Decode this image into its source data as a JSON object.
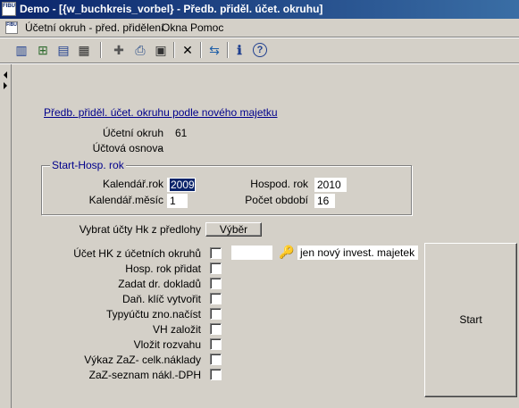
{
  "window": {
    "title": "Demo - [{w_buchkreis_vorbel} - Předb. přiděl. účet. okruhu]",
    "app_icon_text": "FIBU"
  },
  "menu": {
    "items": [
      "Účetní okruh - před. přidělení",
      "Okna",
      "Pomoc"
    ]
  },
  "toolbar": {
    "icons": [
      "columns-icon",
      "tree-icon",
      "book-icon",
      "calculator-icon",
      "plus-icon",
      "printer-icon",
      "preview-icon",
      "close-icon",
      "transfer-icon",
      "info-icon",
      "help-icon"
    ],
    "glyphs": {
      "columns": "▥",
      "tree": "⊞",
      "book": "▤",
      "calc": "▦",
      "plus": "✚",
      "print": "⎙",
      "preview": "▣",
      "close": "✕",
      "transfer": "⇆",
      "info": "ℹ",
      "help": "?"
    }
  },
  "form": {
    "heading_link": "Předb. přiděl. účet. okruhu podle nového majetku",
    "ucetni_okruh_label": "Účetní okruh",
    "ucetni_okruh_value": "61",
    "uctova_osnova_label": "Účtová osnova",
    "uctova_osnova_value": "-",
    "group_title": "Start-Hosp. rok",
    "kalendar_rok_label": "Kalendář.rok",
    "kalendar_rok_value": "2009",
    "hospod_rok_label": "Hospod. rok",
    "hospod_rok_value": "2010",
    "kalendar_mesic_label": "Kalendář.měsíc",
    "kalendar_mesic_value": "1",
    "pocet_obdobi_label": "Počet období",
    "pocet_obdobi_value": "16",
    "vybrat_label": "Vybrat účty Hk z předlohy",
    "vyber_button": "Výběr",
    "ucet_hk_label": "Účet HK z účetních okruhů",
    "ucet_hk_value": "",
    "invest_text": "jen nový invest. majetek",
    "start_button": "Start"
  },
  "checkboxes": [
    {
      "label": "Účet HK z účetních okruhů",
      "checked": false
    },
    {
      "label": "Hosp. rok přidat",
      "checked": false
    },
    {
      "label": "Zadat dr. dokladů",
      "checked": false
    },
    {
      "label": "Daň. klíč vytvořit",
      "checked": false
    },
    {
      "label": "Typyúčtu zno.načíst",
      "checked": false
    },
    {
      "label": "VH založit",
      "checked": false
    },
    {
      "label": "Vložit rozvahu",
      "checked": false
    },
    {
      "label": "Výkaz ZaZ- celk.náklady",
      "checked": false
    },
    {
      "label": "ZaZ-seznam nákl.-DPH",
      "checked": false
    }
  ]
}
